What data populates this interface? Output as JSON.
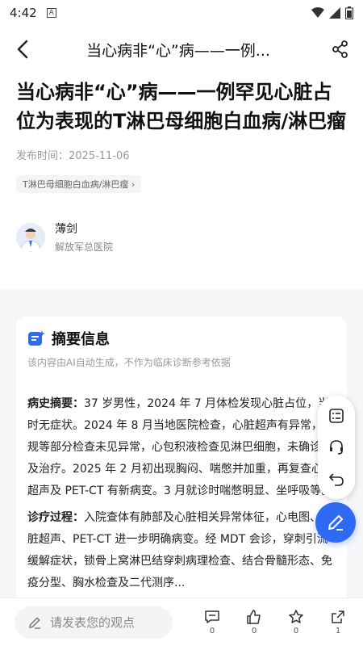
{
  "status_bar": {
    "time": "4:42",
    "app_badge": "A"
  },
  "nav": {
    "title": "当心病非“心”病——一例..."
  },
  "article": {
    "title": "当心病非“心”病——一例罕见心脏占位为表现的T淋巴母细胞白血病/淋巴瘤",
    "publish_time": "发布时间：2025-11-06",
    "tag": "T淋巴母细胞白血病/淋巴瘤 ›",
    "author_name": "薄剑",
    "author_org": "解放军总医院"
  },
  "summary": {
    "title": "摘要信息",
    "note": "该内容由AI自动生成，不作为临床诊断参考依据",
    "history_label": "病史摘要：",
    "history_text": "37 岁男性，2024 年 7 月体检发现心脏占位，当时无症状。2024 年 8 月当地医院检查，心脏超声有异常，常规等部分检查未见异常，心包积液检查见淋巴细胞，未确诊断及治疗。2025 年 2 月初出现胸闷、喘憋并加重，再复查心脏超声及 PET-CT 有新病变。3 月就诊时喘憋明显、坐呼吸等。",
    "process_label": "诊疗过程：",
    "process_text": "入院查体有肺部及心脏相关异常体征，心电图、心脏超声、PET-CT 进一步明确病变。经 MDT 会诊，穿刺引流缓解症状，锁骨上窝淋巴结穿刺病理检查、结合骨髓形态、免疫分型、胸水检查及二代测序..."
  },
  "bottom_bar": {
    "comment_placeholder": "请发表您的观点",
    "comment_count": "0",
    "like_count": "0",
    "collect_count": "0",
    "share_count": "1"
  },
  "colors": {
    "accent": "#2f6bf2",
    "background": "#f5f6f8"
  },
  "icons": [
    "back-icon",
    "share-icon",
    "sparkle-icon",
    "list-icon",
    "headset-icon",
    "undo-icon",
    "pen-icon",
    "comment-icon",
    "like-icon",
    "collect-icon",
    "forward-icon"
  ]
}
